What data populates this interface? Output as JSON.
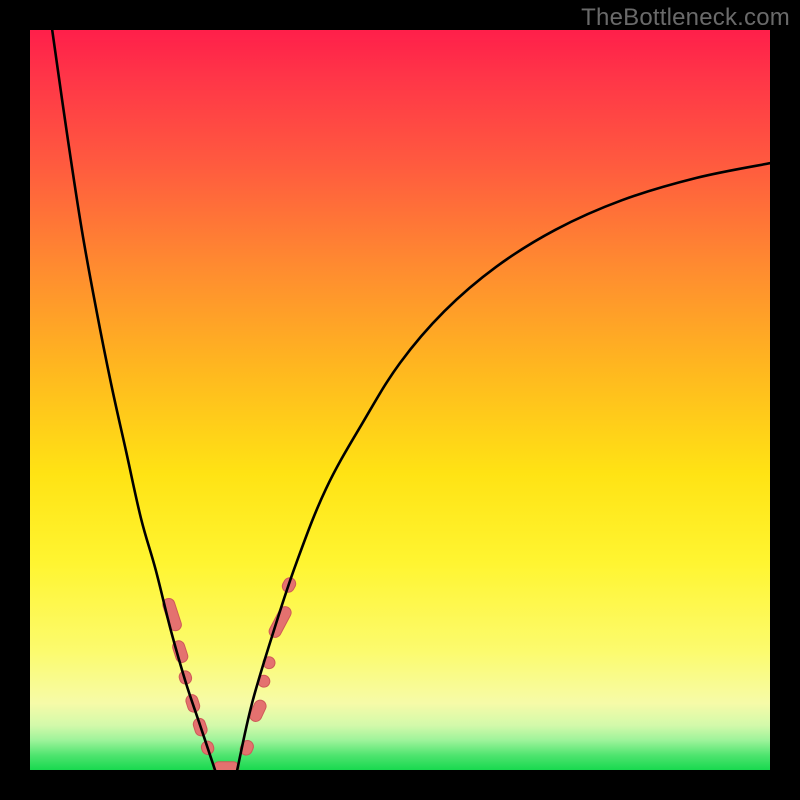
{
  "watermark": {
    "text": "TheBottleneck.com"
  },
  "colors": {
    "curve_stroke": "#000000",
    "marker_fill": "#e4716f",
    "marker_stroke": "#cf5a58"
  },
  "chart_data": {
    "type": "line",
    "title": "",
    "xlabel": "",
    "ylabel": "",
    "xlim": [
      0,
      100
    ],
    "ylim": [
      0,
      100
    ],
    "grid": false,
    "legend": false,
    "annotations": [
      "TheBottleneck.com"
    ],
    "series": [
      {
        "name": "bottleneck-curve-left",
        "x": [
          3,
          5,
          7,
          9,
          11,
          13,
          15,
          17,
          19,
          21,
          23,
          25
        ],
        "y": [
          100,
          86,
          73,
          62,
          52,
          43,
          34,
          27,
          19,
          12,
          6,
          0
        ]
      },
      {
        "name": "bottleneck-curve-right",
        "x": [
          28,
          30,
          33,
          36,
          40,
          45,
          50,
          56,
          63,
          71,
          80,
          90,
          100
        ],
        "y": [
          0,
          9,
          19,
          28,
          38,
          47,
          55,
          62,
          68,
          73,
          77,
          80,
          82
        ]
      }
    ],
    "markers": [
      {
        "x": 19.2,
        "y": 21.0,
        "len": 4.5,
        "angle": 72
      },
      {
        "x": 20.3,
        "y": 16.0,
        "len": 3.0,
        "angle": 72
      },
      {
        "x": 21.0,
        "y": 12.5,
        "len": 1.8,
        "angle": 72
      },
      {
        "x": 22.0,
        "y": 9.0,
        "len": 2.4,
        "angle": 72
      },
      {
        "x": 23.0,
        "y": 5.8,
        "len": 2.4,
        "angle": 72
      },
      {
        "x": 24.0,
        "y": 3.0,
        "len": 1.8,
        "angle": 72
      },
      {
        "x": 26.5,
        "y": 0.3,
        "len": 3.5,
        "angle": 0
      },
      {
        "x": 29.3,
        "y": 3.0,
        "len": 2.0,
        "angle": -65
      },
      {
        "x": 30.8,
        "y": 8.0,
        "len": 3.0,
        "angle": -65
      },
      {
        "x": 31.6,
        "y": 12.0,
        "len": 1.6,
        "angle": -65
      },
      {
        "x": 32.3,
        "y": 14.5,
        "len": 1.6,
        "angle": -65
      },
      {
        "x": 33.8,
        "y": 20.0,
        "len": 4.5,
        "angle": -62
      },
      {
        "x": 35.0,
        "y": 25.0,
        "len": 2.0,
        "angle": -60
      }
    ]
  }
}
